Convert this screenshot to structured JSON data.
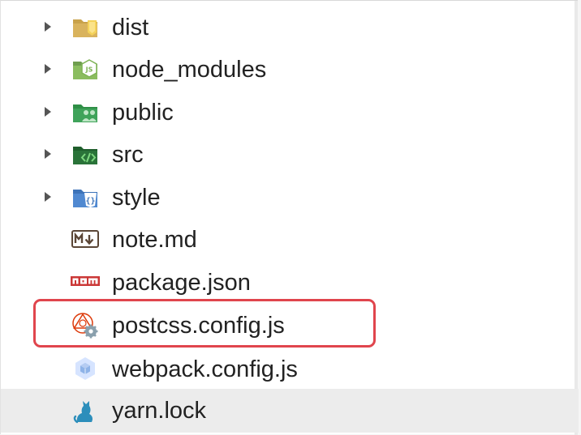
{
  "explorer": {
    "items": [
      {
        "label": "dist",
        "kind": "folder",
        "icon": "dist-folder-icon"
      },
      {
        "label": "node_modules",
        "kind": "folder",
        "icon": "node-modules-folder-icon"
      },
      {
        "label": "public",
        "kind": "folder",
        "icon": "public-folder-icon"
      },
      {
        "label": "src",
        "kind": "folder",
        "icon": "src-folder-icon"
      },
      {
        "label": "style",
        "kind": "folder",
        "icon": "style-folder-icon"
      },
      {
        "label": "note.md",
        "kind": "file",
        "icon": "markdown-file-icon"
      },
      {
        "label": "package.json",
        "kind": "file",
        "icon": "npm-file-icon"
      },
      {
        "label": "postcss.config.js",
        "kind": "file",
        "icon": "postcss-config-icon",
        "highlighted": true
      },
      {
        "label": "webpack.config.js",
        "kind": "file",
        "icon": "webpack-config-icon"
      },
      {
        "label": "yarn.lock",
        "kind": "file",
        "icon": "yarn-lock-icon",
        "hovered": true
      }
    ]
  },
  "colors": {
    "highlight_border": "#e0454d",
    "hover_background": "#ececec",
    "chevron": "#555555"
  }
}
